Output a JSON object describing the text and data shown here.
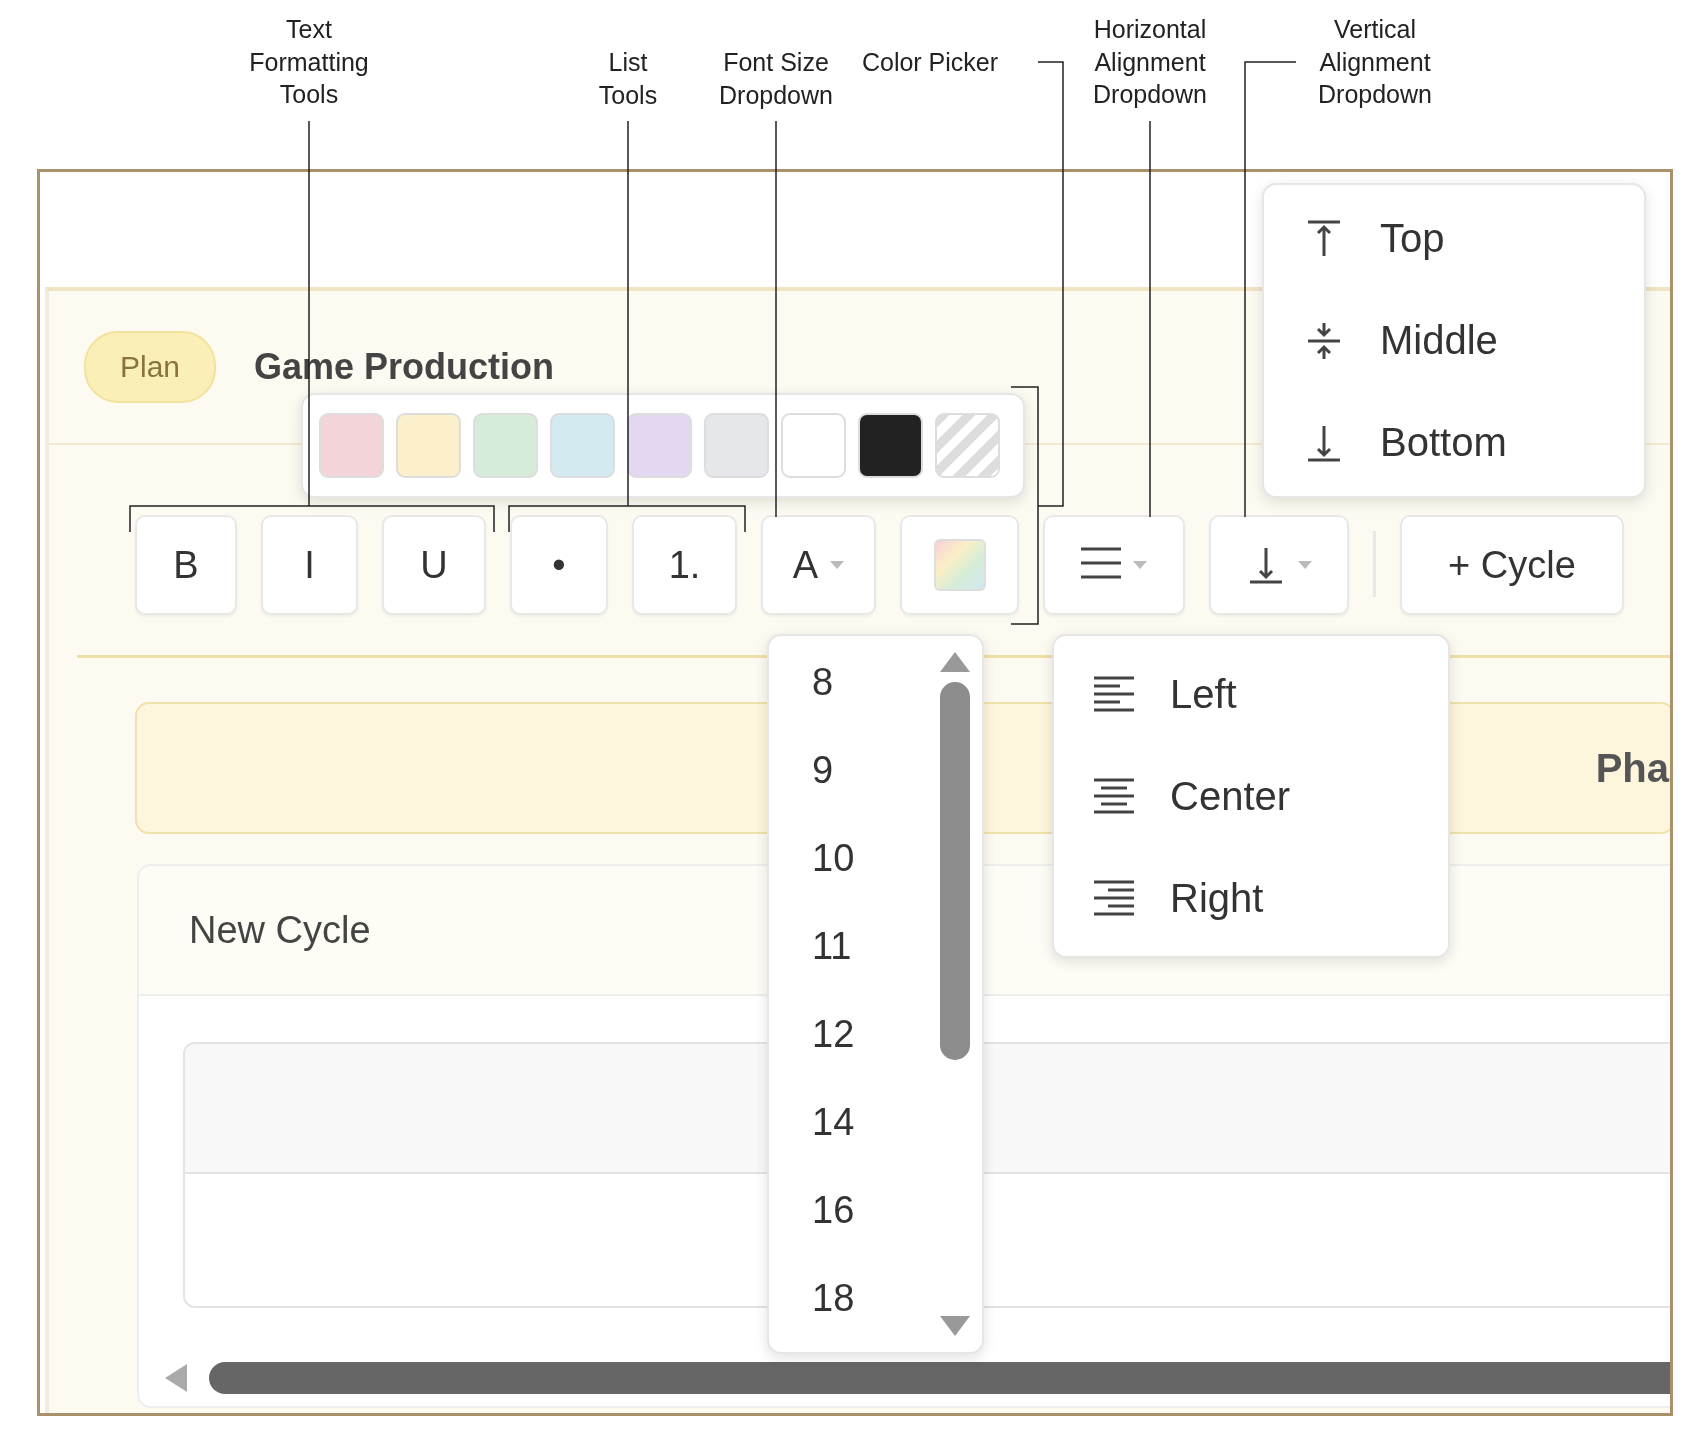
{
  "annotations": [
    {
      "lines": [
        "Text",
        "Formatting",
        "Tools"
      ]
    },
    {
      "lines": [
        "List",
        "Tools"
      ]
    },
    {
      "lines": [
        "Font Size",
        "Dropdown"
      ]
    },
    {
      "lines": [
        "Color Picker"
      ]
    },
    {
      "lines": [
        "Horizontal",
        "Alignment",
        "Dropdown"
      ]
    },
    {
      "lines": [
        "Vertical",
        "Alignment",
        "Dropdown"
      ]
    }
  ],
  "header": {
    "badge": "Plan",
    "title": "Game Production"
  },
  "color_picker": {
    "swatches": [
      {
        "kind": "solid",
        "color": "#f2d4d9"
      },
      {
        "kind": "solid",
        "color": "#fcefcc"
      },
      {
        "kind": "solid",
        "color": "#d5ecd9"
      },
      {
        "kind": "solid",
        "color": "#d3eaf0"
      },
      {
        "kind": "solid",
        "color": "#e3d7f1"
      },
      {
        "kind": "solid",
        "color": "#e6e7ea"
      },
      {
        "kind": "solid",
        "color": "#ffffff"
      },
      {
        "kind": "solid",
        "color": "#222222"
      },
      {
        "kind": "none"
      }
    ]
  },
  "toolbar": {
    "buttons": [
      {
        "kind": "text",
        "label": "B"
      },
      {
        "kind": "text",
        "label": "I"
      },
      {
        "kind": "text",
        "label": "U"
      },
      {
        "kind": "text",
        "label": "•"
      },
      {
        "kind": "text",
        "label": "1."
      },
      {
        "kind": "font_size",
        "label": "A"
      },
      {
        "kind": "color"
      },
      {
        "kind": "halign"
      },
      {
        "kind": "valign"
      },
      {
        "kind": "add",
        "label": "+ Cycle"
      }
    ]
  },
  "font_size_menu": {
    "options": [
      "8",
      "9",
      "10",
      "11",
      "12",
      "14",
      "16",
      "18"
    ]
  },
  "halign_menu": {
    "options": [
      {
        "kind": "left",
        "label": "Left"
      },
      {
        "kind": "center",
        "label": "Center"
      },
      {
        "kind": "right",
        "label": "Right"
      }
    ]
  },
  "valign_menu": {
    "options": [
      {
        "kind": "top",
        "label": "Top"
      },
      {
        "kind": "middle",
        "label": "Middle"
      },
      {
        "kind": "bottom",
        "label": "Bottom"
      }
    ]
  },
  "phase_bar": {
    "label": "Pha"
  },
  "cycle_card": {
    "title": "New Cycle"
  }
}
